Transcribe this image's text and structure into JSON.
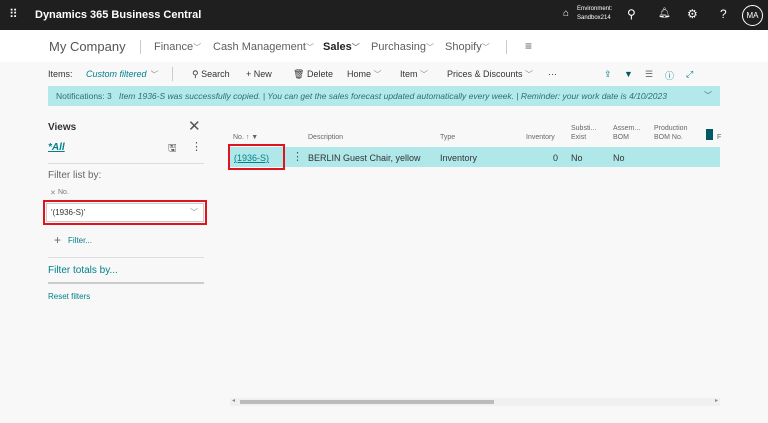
{
  "topbar": {
    "app_title": "Dynamics 365 Business Central",
    "env_label": "Environment:",
    "env_name": "Sandbox214",
    "avatar": "MA"
  },
  "nav": {
    "company": "My Company",
    "items": [
      {
        "label": "Finance"
      },
      {
        "label": "Cash Management"
      },
      {
        "label": "Sales"
      },
      {
        "label": "Purchasing"
      },
      {
        "label": "Shopify"
      }
    ]
  },
  "actions": {
    "page_label": "Items:",
    "view": "Custom filtered",
    "search": "Search",
    "new": "New",
    "delete": "Delete",
    "home": "Home",
    "item": "Item",
    "prices": "Prices & Discounts",
    "more": "···"
  },
  "notification": {
    "count": "Notifications: 3",
    "text": "Item 1936-S was successfully copied. | You can get the sales forecast updated automatically every week. | Reminder: your work date is 4/10/2023"
  },
  "filter_pane": {
    "title": "Views",
    "view_all": "*All",
    "filter_list_by": "Filter list by:",
    "field_label": "No.",
    "field_value": "'(1936-S)'",
    "add_filter": "Filter...",
    "filter_totals": "Filter totals by...",
    "reset": "Reset filters"
  },
  "table": {
    "headers": {
      "no": "No. ↑",
      "description": "Description",
      "type": "Type",
      "inventory": "Inventory",
      "subst_1": "Substi...",
      "subst_2": "Exist",
      "assembly_1": "Assem...",
      "assembly_2": "BOM",
      "production_1": "Production",
      "production_2": "BOM No.",
      "next": "F"
    },
    "rows": [
      {
        "no": "(1936-S)",
        "description": "BERLIN Guest Chair, yellow",
        "type": "Inventory",
        "inventory": "0",
        "subst": "No",
        "assembly": "No"
      }
    ]
  },
  "colors": {
    "topbar": "#1f1f1f",
    "accent": "#00808a",
    "notification": "#b3e9ea",
    "selected_row": "#b0e8ea",
    "highlight_box": "#e0141e"
  }
}
